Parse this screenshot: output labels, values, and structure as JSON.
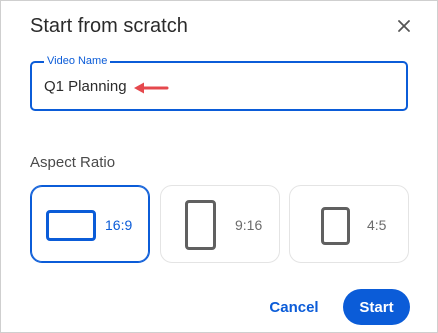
{
  "dialog": {
    "title": "Start from scratch",
    "close_icon": "close-icon"
  },
  "video_name": {
    "label": "Video Name",
    "value": "Q1 Planning",
    "annotation_icon": "left-arrow-icon",
    "annotation_color": "#e5484d"
  },
  "aspect_ratio": {
    "label": "Aspect Ratio",
    "selected": "16:9",
    "options": [
      {
        "label": "16:9",
        "icon": "landscape-rectangle-icon",
        "selected": true
      },
      {
        "label": "9:16",
        "icon": "portrait-rectangle-icon",
        "selected": false
      },
      {
        "label": "4:5",
        "icon": "portrait-4-5-rectangle-icon",
        "selected": false
      }
    ]
  },
  "actions": {
    "cancel_label": "Cancel",
    "start_label": "Start"
  },
  "colors": {
    "accent": "#0b5cd8",
    "text": "#2b2b2b",
    "muted": "#6b6b6b"
  }
}
